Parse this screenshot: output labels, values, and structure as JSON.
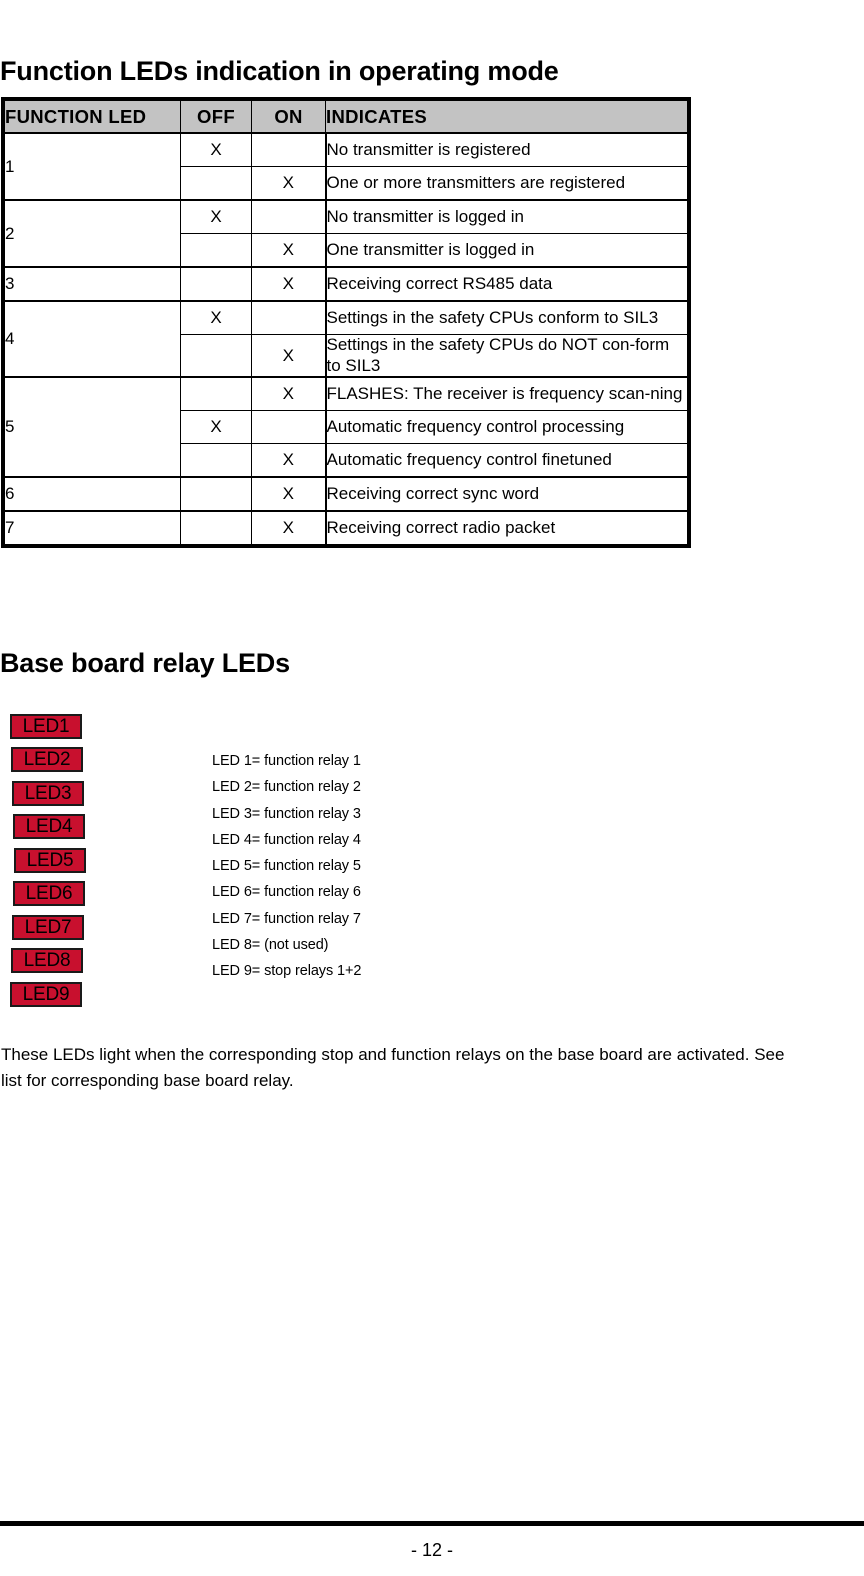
{
  "headings": {
    "function_leds": "Function LEDs indication in operating mode",
    "base_board": "Base board relay LEDs"
  },
  "table": {
    "columns": [
      "FUNCTION LED",
      "OFF",
      "ON",
      "INDICATES"
    ],
    "rows": [
      {
        "led": "1",
        "off": "X",
        "on": "",
        "indicates": "No transmitter is registered"
      },
      {
        "led": "",
        "off": "",
        "on": "X",
        "indicates": "One or more transmitters are registered"
      },
      {
        "led": "2",
        "off": "X",
        "on": "",
        "indicates": "No transmitter is logged in"
      },
      {
        "led": "",
        "off": "",
        "on": "X",
        "indicates": "One transmitter is logged in"
      },
      {
        "led": "3",
        "off": "",
        "on": "X",
        "indicates": "Receiving correct RS485 data"
      },
      {
        "led": "4",
        "off": "X",
        "on": "",
        "indicates": "Settings in the safety CPUs conform to SIL3"
      },
      {
        "led": "",
        "off": "",
        "on": "X",
        "indicates": "Settings in the safety CPUs do NOT con-form to SIL3"
      },
      {
        "led": "5",
        "off": "",
        "on": "X",
        "indicates": "FLASHES: The receiver is frequency scan-ning"
      },
      {
        "led": "",
        "off": "X",
        "on": "",
        "indicates": "Automatic frequency control processing"
      },
      {
        "led": "",
        "off": "",
        "on": "X",
        "indicates": "Automatic frequency control finetuned"
      },
      {
        "led": "6",
        "off": "",
        "on": "X",
        "indicates": "Receiving correct sync word"
      },
      {
        "led": "7",
        "off": "",
        "on": "X",
        "indicates": "Receiving correct radio packet"
      }
    ]
  },
  "led_boxes": [
    {
      "label": "LED1"
    },
    {
      "label": "LED2"
    },
    {
      "label": "LED3"
    },
    {
      "label": "LED4"
    },
    {
      "label": "LED5"
    },
    {
      "label": "LED6"
    },
    {
      "label": "LED7"
    },
    {
      "label": "LED8"
    },
    {
      "label": "LED9"
    }
  ],
  "led_legend": [
    "LED 1= function relay 1",
    "LED 2= function relay 2",
    "LED 3= function relay 3",
    "LED 4= function relay 4",
    "LED 5= function relay 5",
    "LED 6= function relay 6",
    "LED 7= function relay 7",
    "LED 8= (not used)",
    "LED 9= stop relays 1+2"
  ],
  "paragraph": {
    "line1": "These LEDs light when the corresponding stop and function relays on the base board are activated. See",
    "line2": "list for corresponding base board relay."
  },
  "footer": {
    "page_number": "- 12 -"
  },
  "colors": {
    "led_red": "#c8102e",
    "header_gray": "#c3c3c3",
    "text_black": "#000000"
  }
}
